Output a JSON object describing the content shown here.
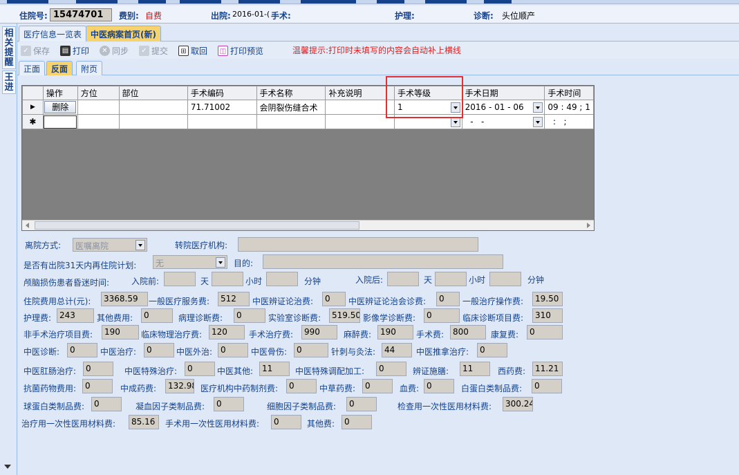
{
  "info": {
    "admission_no_label": "住院号:",
    "admission_no": "15474701",
    "fee_type_label": "费别:",
    "fee_type": "自费",
    "discharge_label": "出院:",
    "discharge_value": "2016-01-(",
    "surgery_label": "手术:",
    "nursing_label": "护理:",
    "diagnosis_label": "诊断:",
    "diagnosis_value": "头位顺产"
  },
  "side_tabs": [
    "相关提醒",
    "王进"
  ],
  "main_tabs": [
    {
      "label": "医疗信息一览表"
    },
    {
      "label": "中医病案首页(新)"
    }
  ],
  "toolbar": {
    "save": "保存",
    "print": "打印",
    "sync": "同步",
    "submit": "提交",
    "retrieve": "取回",
    "print_preview": "打印预览",
    "tip": "温馨提示:打印时未填写的内容会自动补上横线"
  },
  "inner_tabs": [
    {
      "label": "正面"
    },
    {
      "label": "反面"
    },
    {
      "label": "附页"
    }
  ],
  "grid": {
    "columns": [
      "操作",
      "方位",
      "部位",
      "手术编码",
      "手术名称",
      "补充说明",
      "手术等级",
      "手术日期",
      "手术时间"
    ],
    "row1": {
      "marker": "▶",
      "action": "删除",
      "position": "",
      "site": "",
      "code": "71.71002",
      "name": "会阴裂伤缝合术",
      "note": "",
      "level": "1",
      "date": "2016 - 01 - 06",
      "time": "09 : 49 ; 1"
    },
    "row2": {
      "marker": "✱",
      "date": "  -   -",
      "time": "  :   ;"
    }
  },
  "form": {
    "discharge_method_label": "离院方式:",
    "discharge_method": "医嘱离院",
    "transfer_org_label": "转院医疗机构:",
    "readmit_label": "是否有出院31天内再住院计划:",
    "readmit_value": "无",
    "purpose_label": "目的:",
    "coma_label": "颅脑损伤患者昏迷时间:",
    "before_admit_label": "入院前:",
    "after_admit_label": "入院后:",
    "day": "天",
    "hour": "小时",
    "minute": "分钟",
    "fees": {
      "total_label": "住院费用总计(元):",
      "total": "3368.59",
      "general_service_label": "一般医疗服务费:",
      "general_service": "512",
      "tcm_diag_label": "中医辨证论治费:",
      "tcm_diag": "0",
      "tcm_consult_label": "中医辨证论治会诊费:",
      "tcm_consult": "0",
      "general_treat_label": "一般治疗操作费:",
      "general_treat": "19.50",
      "nursing_label": "护理费:",
      "nursing": "243",
      "other_label": "其他费用:",
      "other": "0",
      "pathology_label": "病理诊断费:",
      "pathology": "0",
      "lab_label": "实验室诊断费:",
      "lab": "519.50",
      "imaging_label": "影像学诊断费:",
      "imaging": "0",
      "clinical_diag_label": "临床诊断项目费:",
      "clinical_diag": "310",
      "nonsurg_label": "非手术治疗项目费:",
      "nonsurg": "190",
      "physio_label": "临床物理治疗费:",
      "physio": "120",
      "surg_treat_label": "手术治疗费:",
      "surg_treat": "990",
      "anesth_label": "麻醉费:",
      "anesth": "190",
      "surgery_label": "手术费:",
      "surgery": "800",
      "rehab_label": "康复费:",
      "rehab": "0",
      "tcm_diagnosis_label": "中医诊断:",
      "tcm_diagnosis": "0",
      "tcm_treat_label": "中医治疗:",
      "tcm_treat": "0",
      "tcm_external_label": "中医外治:",
      "tcm_external": "0",
      "tcm_bone_label": "中医骨伤:",
      "tcm_bone": "0",
      "acup_label": "针刺与灸法:",
      "acup": "44",
      "tuina_label": "中医推拿治疗:",
      "tuina": "0",
      "anorectal_label": "中医肛肠治疗:",
      "anorectal": "0",
      "tcm_special_label": "中医特殊治疗:",
      "tcm_special": "0",
      "tcm_other_label": "中医其他:",
      "tcm_other": "11",
      "tcm_prep_label": "中医特殊调配加工:",
      "tcm_prep": "0",
      "diet_label": "辨证施膳:",
      "diet": "11",
      "western_label": "西药费:",
      "western": "11.21",
      "antibiotic_label": "抗菌药物费用:",
      "antibiotic": "0",
      "patent_label": "中成药费:",
      "patent": "132.98",
      "inhouse_label": "医疗机构中药制剂费:",
      "inhouse": "0",
      "herbal_label": "中草药费:",
      "herbal": "0",
      "blood_label": "血费:",
      "blood": "0",
      "albumin_label": "白蛋白类制品费:",
      "albumin": "0",
      "globulin_label": "球蛋白类制品费:",
      "globulin": "0",
      "coag_label": "凝血因子类制品费:",
      "coag": "0",
      "cytokine_label": "细胞因子类制品费:",
      "cytokine": "0",
      "exam_material_label": "检查用一次性医用材料费:",
      "exam_material": "300.24",
      "treat_material_label": "治疗用一次性医用材料费:",
      "treat_material": "85.16",
      "surg_material_label": "手术用一次性医用材料费:",
      "surg_material": "0",
      "other2_label": "其他费:",
      "other2": "0"
    }
  }
}
